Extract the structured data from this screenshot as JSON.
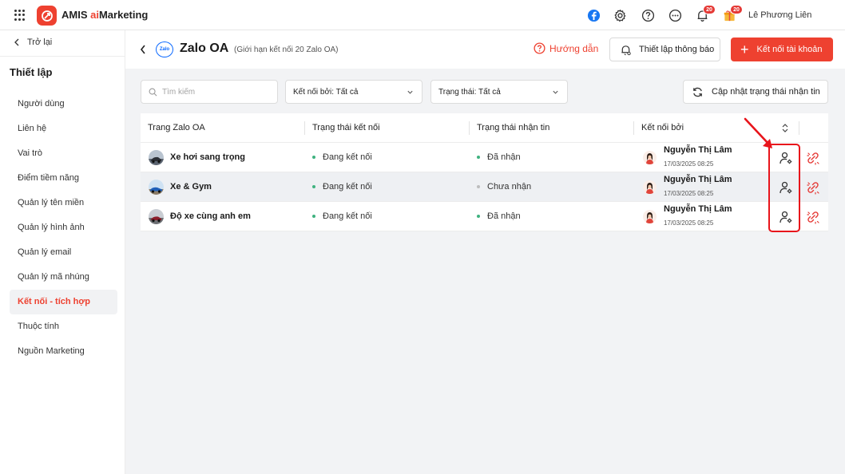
{
  "app": {
    "brand_prefix": "AMIS ",
    "brand_ai": "ai",
    "brand_suffix": "Marketing",
    "notif_count": "20",
    "gift_count": "20",
    "user_name": "Lê Phương Liên"
  },
  "sidebar": {
    "back_label": "Trở lại",
    "title": "Thiết lập",
    "items": [
      {
        "label": "Người dùng",
        "active": false
      },
      {
        "label": "Liên hệ",
        "active": false
      },
      {
        "label": "Vai trò",
        "active": false
      },
      {
        "label": "Điểm tiềm năng",
        "active": false
      },
      {
        "label": "Quản lý tên miền",
        "active": false
      },
      {
        "label": "Quản lý hình ảnh",
        "active": false
      },
      {
        "label": "Quản lý email",
        "active": false
      },
      {
        "label": "Quản lý mã nhúng",
        "active": false
      },
      {
        "label": "Kết nối - tích hợp",
        "active": true
      },
      {
        "label": "Thuộc tính",
        "active": false
      },
      {
        "label": "Nguồn Marketing",
        "active": false
      }
    ]
  },
  "header": {
    "logo_text": "Zalo",
    "title": "Zalo OA",
    "subtitle": "(Giới hạn kết nối 20 Zalo OA)",
    "help_label": "Hướng dẫn",
    "notify_label": "Thiết lập thông báo",
    "connect_label": "Kết nối tài khoản"
  },
  "filters": {
    "search_placeholder": "Tìm kiếm",
    "connected_by": "Kết nối bởi: Tất cả",
    "status": "Trạng thái: Tất cả",
    "refresh_label": "Cập nhật trạng thái nhận tin"
  },
  "table": {
    "columns": [
      "Trang Zalo OA",
      "Trạng thái kết nối",
      "Trạng thái nhận tin",
      "Kết nối bởi"
    ],
    "rows": [
      {
        "name": "Xe hơi sang trọng",
        "connect_status": "Đang kết nối",
        "receive_status": "Đã nhận",
        "receive_color": "#3fb27f",
        "user": "Nguyễn Thị Lâm",
        "date": "17/03/2025 08:25"
      },
      {
        "name": "Xe & Gym",
        "connect_status": "Đang kết nối",
        "receive_status": "Chưa nhận",
        "receive_color": "#bdbdbd",
        "user": "Nguyễn Thị Lâm",
        "date": "17/03/2025 08:25"
      },
      {
        "name": "Độ xe cùng anh em",
        "connect_status": "Đang kết nối",
        "receive_status": "Đã nhận",
        "receive_color": "#3fb27f",
        "user": "Nguyễn Thị Lâm",
        "date": "17/03/2025 08:25"
      }
    ]
  },
  "colors": {
    "accent": "#ee4130",
    "connected_dot": "#3fb27f",
    "annotation": "#e8141b"
  }
}
